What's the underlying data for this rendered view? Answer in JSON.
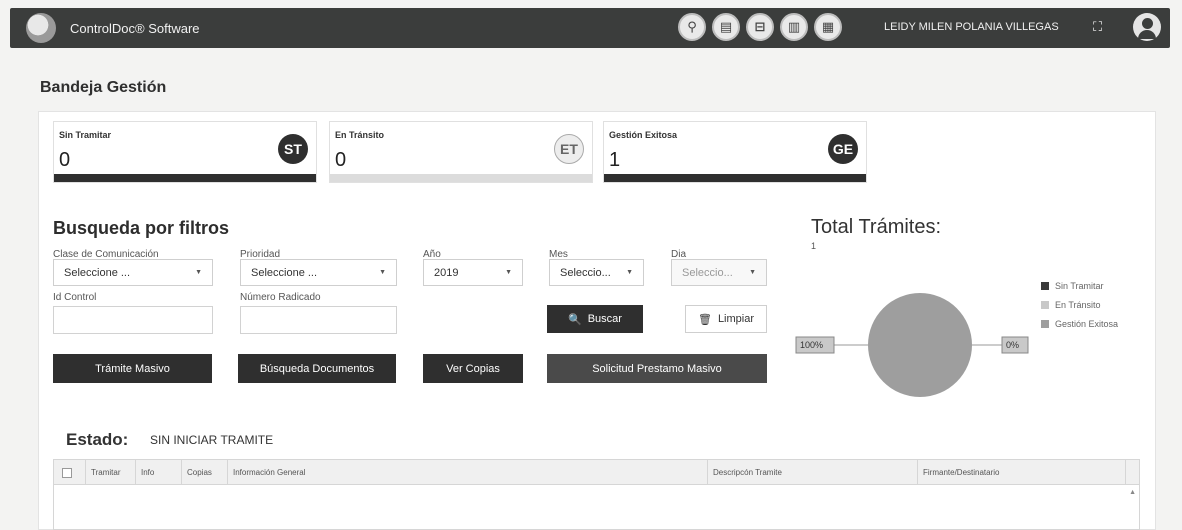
{
  "app": {
    "title": "ControlDoc® Software",
    "username": "LEIDY MILEN POLANIA VILLEGAS"
  },
  "toolbar": {
    "icons": [
      "search-icon",
      "document-search-icon",
      "inbox-icon",
      "tray-icon",
      "document-icon"
    ],
    "icon_glyphs": [
      "⚲",
      "▤",
      "⊟",
      "▥",
      "▦"
    ],
    "expand_glyph": "⛶"
  },
  "page": {
    "title": "Bandeja Gestión"
  },
  "cards": [
    {
      "label": "Sin Tramitar",
      "value": "0",
      "badge": "ST"
    },
    {
      "label": "En Tránsito",
      "value": "0",
      "badge": "ET"
    },
    {
      "label": "Gestión Exitosa",
      "value": "1",
      "badge": "GE"
    }
  ],
  "filters": {
    "title": "Busqueda por filtros",
    "clase_label": "Clase de Comunicación",
    "clase_value": "Seleccione ...",
    "prioridad_label": "Prioridad",
    "prioridad_value": "Seleccione ...",
    "anio_label": "Año",
    "anio_value": "2019",
    "mes_label": "Mes",
    "mes_value": "Seleccio...",
    "dia_label": "Dia",
    "dia_value": "Seleccio...",
    "id_label": "Id Control",
    "radicado_label": "Número Radicado",
    "caret": "▼"
  },
  "buttons": {
    "buscar": "Buscar",
    "limpiar": "Limpiar",
    "masivo": "Trámite Masivo",
    "busqueda_docs": "Búsqueda Documentos",
    "copias": "Ver Copias",
    "prestamo": "Solicitud Prestamo Masivo",
    "buscar_icon": "🔍",
    "limpiar_icon": "🗑"
  },
  "chart_data": {
    "type": "pie",
    "title": "Total Trámites:",
    "subtitle": "1",
    "series": [
      {
        "name": "Sin Tramitar",
        "value": 0,
        "color": "#3a3a3a"
      },
      {
        "name": "En Tránsito",
        "value": 0,
        "color": "#c8c8c8"
      },
      {
        "name": "Gestión Exitosa",
        "value": 1,
        "color": "#9e9e9e"
      }
    ],
    "data_labels": [
      "100%",
      "0%"
    ],
    "legend_position": "right"
  },
  "estado": {
    "label": "Estado:",
    "value": "SIN INICIAR TRAMITE"
  },
  "table": {
    "headers": [
      "Tramitar",
      "Info",
      "Copias",
      "Información General",
      "Descripcón Tramite",
      "Firmante/Destinatario"
    ],
    "scroll_glyph": "▲"
  }
}
